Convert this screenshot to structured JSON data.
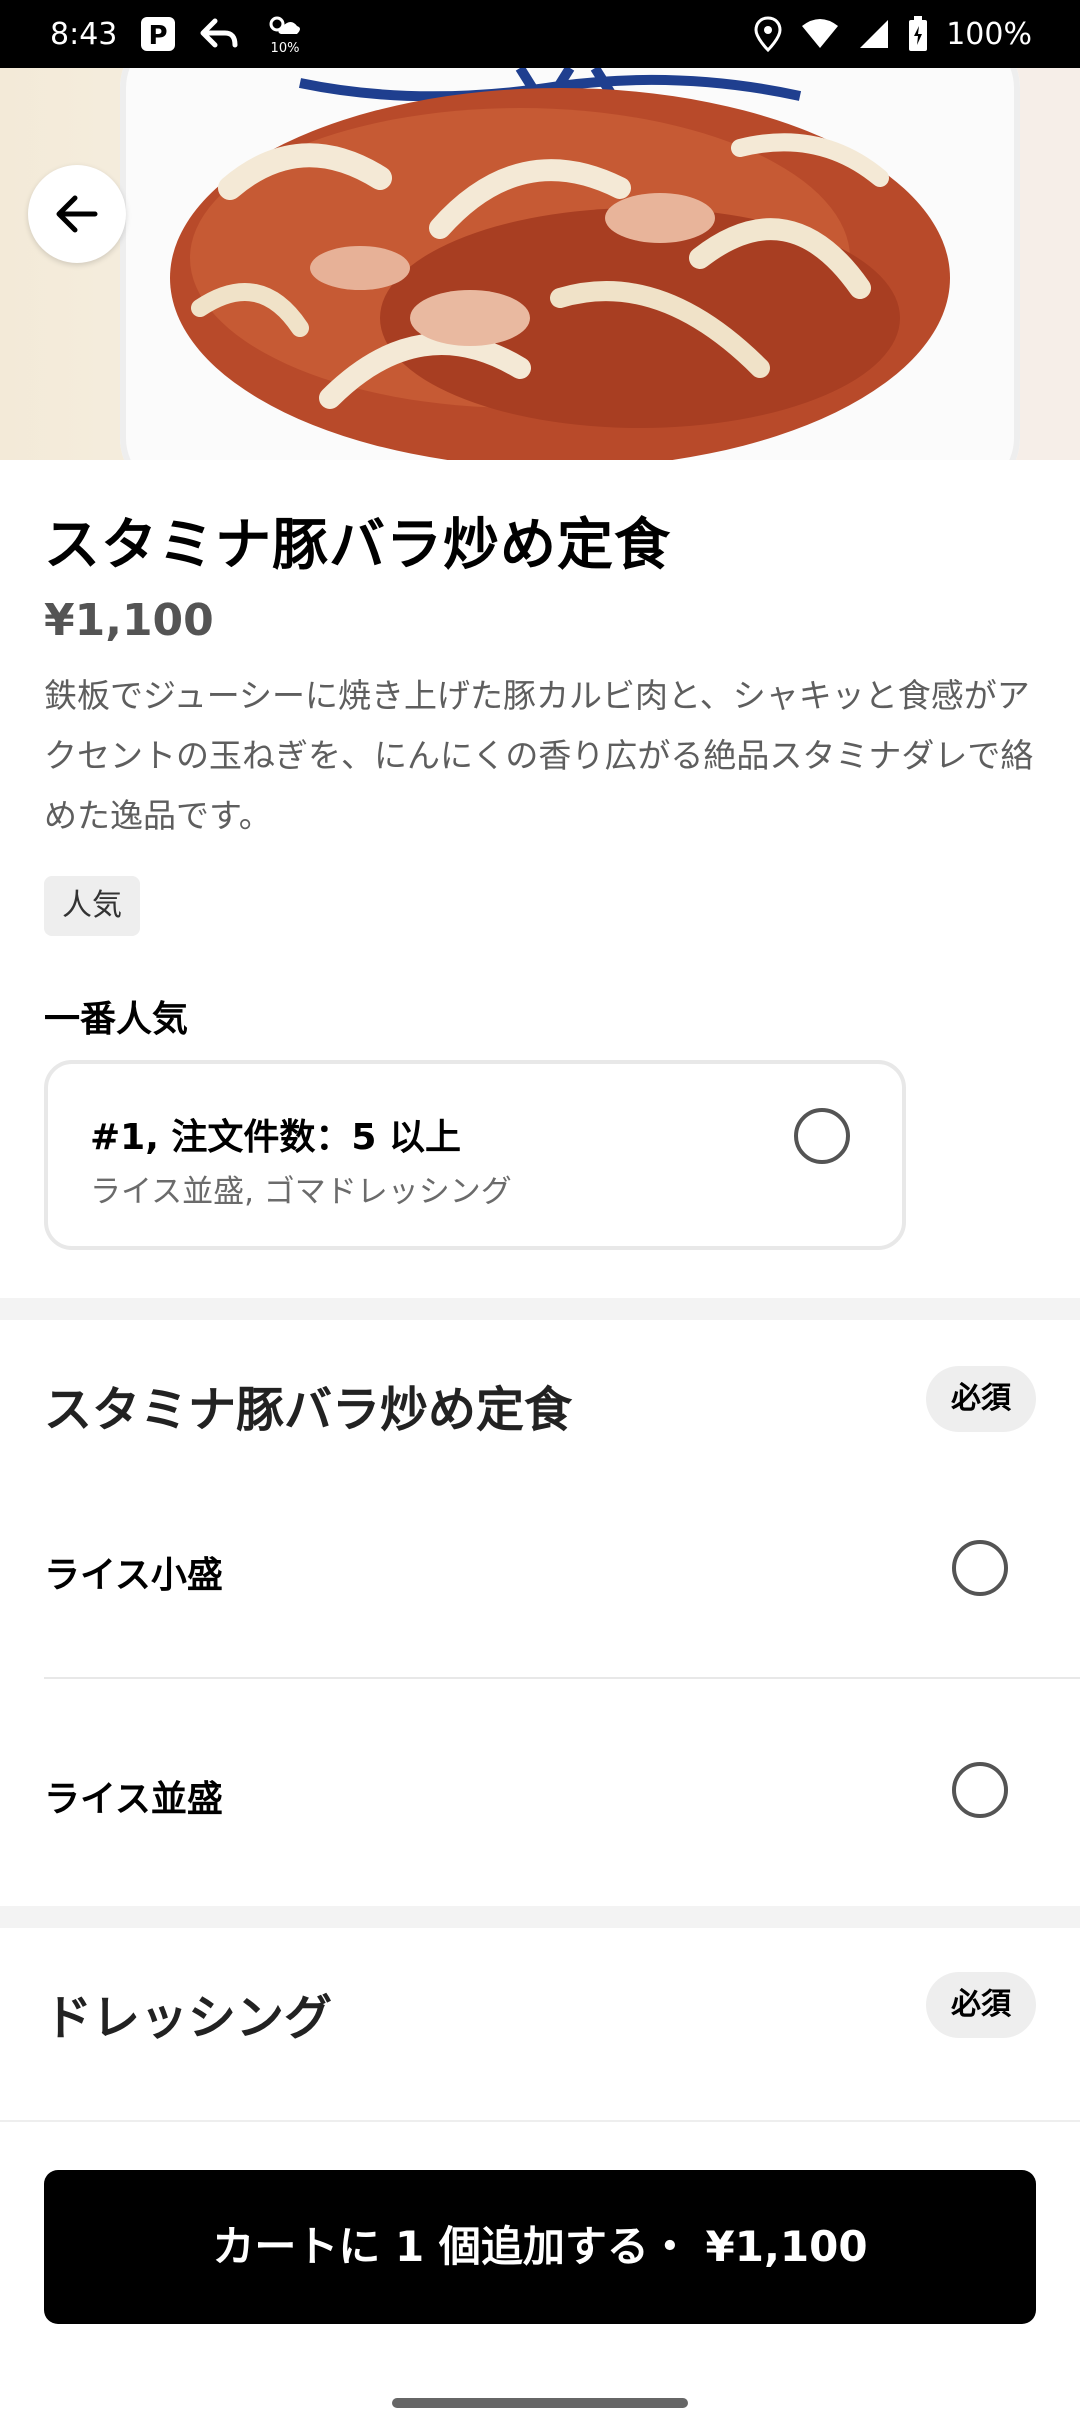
{
  "status_bar": {
    "time": "8:43",
    "battery_text": "100%",
    "icons_left": [
      "parking-app-icon",
      "reply-arrow-icon",
      "weather-icon"
    ],
    "weather_percent": "10%",
    "icons_right": [
      "location-icon",
      "wifi-icon",
      "signal-icon",
      "battery-icon"
    ]
  },
  "product": {
    "title": "スタミナ豚バラ炒め定食",
    "price": "¥1,100",
    "description": "鉄板でジューシーに焼き上げた豚カルビ肉と、シャキッと食感がアクセントの玉ねぎを、にんにくの香り広がる絶品スタミナダレで絡めた逸品です。",
    "tag": "人気"
  },
  "popular": {
    "label": "一番人気",
    "card_title": "#1, 注文件数：5 以上",
    "card_subtitle": "ライス並盛, ゴマドレッシング"
  },
  "sections": [
    {
      "title": "スタミナ豚バラ炒め定食",
      "badge": "必須",
      "options": [
        {
          "label": "ライス小盛"
        },
        {
          "label": "ライス並盛"
        }
      ]
    },
    {
      "title": "ドレッシング",
      "badge": "必須"
    }
  ],
  "cart_button": "カートに 1 個追加する・ ¥1,100",
  "colors": {
    "primary": "#000000",
    "muted_text": "#5e5e5e",
    "badge_bg": "#eeeeee"
  }
}
